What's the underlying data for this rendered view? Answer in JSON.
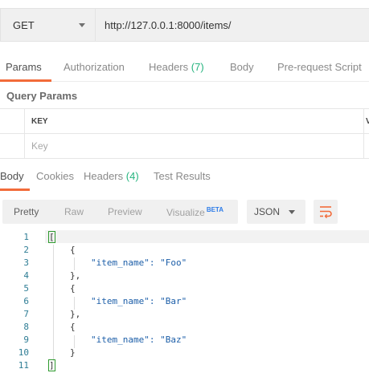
{
  "request": {
    "method": "GET",
    "url": "http://127.0.0.1:8000/items/"
  },
  "request_tabs": [
    {
      "label": "Params",
      "active": true
    },
    {
      "label": "Authorization"
    },
    {
      "label": "Headers",
      "count": "(7)"
    },
    {
      "label": "Body"
    },
    {
      "label": "Pre-request Script"
    }
  ],
  "query_params": {
    "title": "Query Params",
    "key_header": "KEY",
    "value_header": "V",
    "key_placeholder": "Key"
  },
  "response_tabs": [
    {
      "label": "Body",
      "active": true
    },
    {
      "label": "Cookies"
    },
    {
      "label": "Headers",
      "count": "(4)"
    },
    {
      "label": "Test Results"
    }
  ],
  "response_view": {
    "modes": [
      "Pretty",
      "Raw",
      "Preview",
      "Visualize"
    ],
    "active_mode": "Pretty",
    "beta_badge": "BETA",
    "format": "JSON"
  },
  "response_body": {
    "line_numbers": [
      "1",
      "2",
      "3",
      "4",
      "5",
      "6",
      "7",
      "8",
      "9",
      "10",
      "11"
    ],
    "lines": [
      "[",
      "{",
      "\"item_name\": \"Foo\"",
      "},",
      "{",
      "\"item_name\": \"Bar\"",
      "},",
      "{",
      "\"item_name\": \"Baz\"",
      "}",
      "]"
    ],
    "items": [
      "Foo",
      "Bar",
      "Baz"
    ]
  },
  "colors": {
    "accent": "#f26b3a",
    "count": "#26b47f",
    "beta": "#2d7ce8",
    "line_number": "#2f7d95"
  },
  "icons": {
    "method_dropdown": "chevron-down-icon",
    "format_dropdown": "chevron-down-icon",
    "wrap": "wrap-lines-icon"
  }
}
